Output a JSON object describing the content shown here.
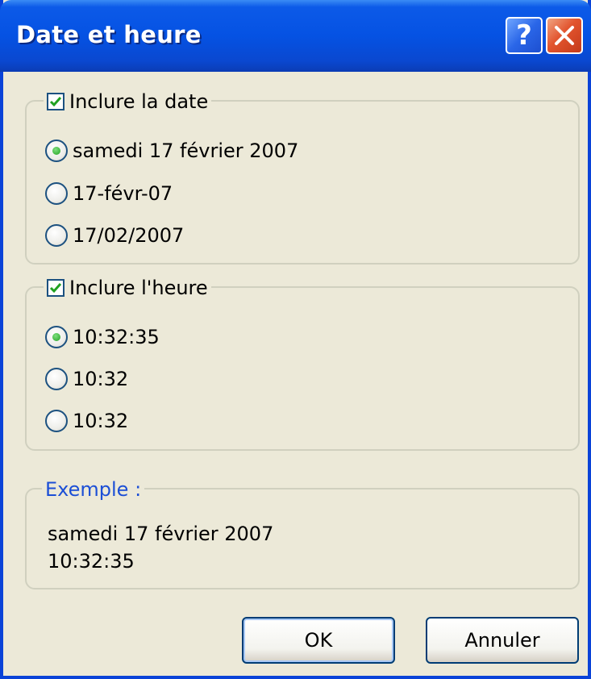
{
  "window": {
    "title": "Date et heure"
  },
  "titlebar": {
    "help_label": "?",
    "close_icon": "close-icon"
  },
  "date_group": {
    "checkbox_label": "Inclure la date",
    "checked": true,
    "options": [
      "samedi 17 février 2007",
      "17-févr-07",
      "17/02/2007"
    ],
    "selected_index": 0
  },
  "time_group": {
    "checkbox_label": "Inclure l'heure",
    "checked": true,
    "options": [
      "10:32:35",
      "10:32",
      "10:32"
    ],
    "selected_index": 0
  },
  "example": {
    "legend": "Exemple :",
    "line1": "samedi 17 février 2007",
    "line2": "10:32:35"
  },
  "buttons": {
    "ok": "OK",
    "cancel": "Annuler"
  },
  "colors": {
    "accent": "#0a43d8",
    "example_legend": "#1c4fd6",
    "check": "#21a121"
  }
}
